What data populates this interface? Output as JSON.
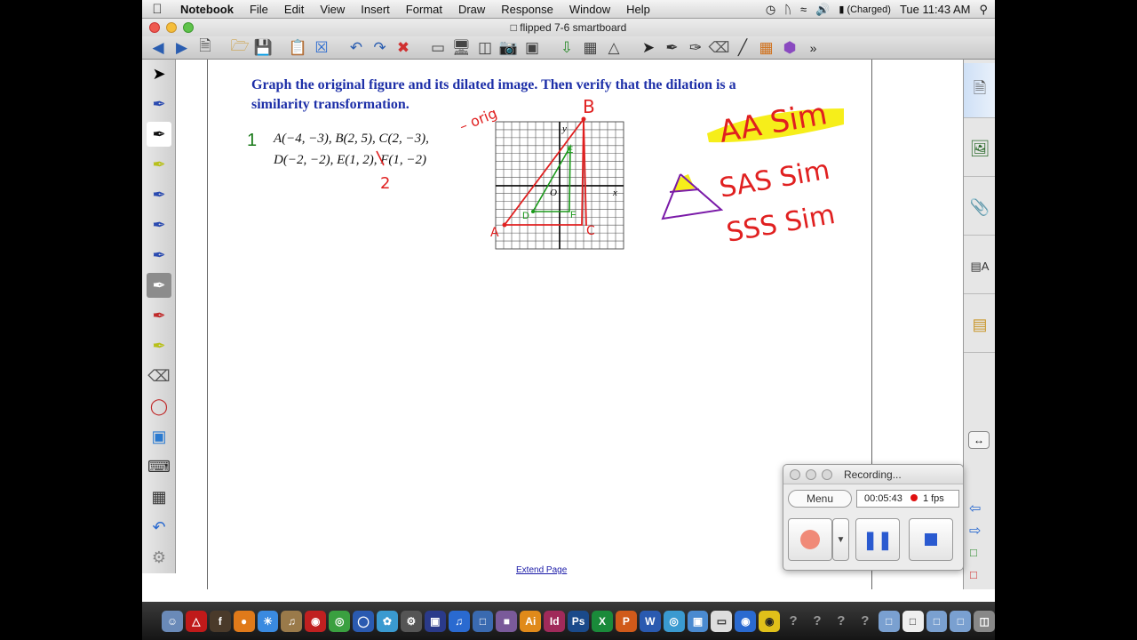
{
  "menubar": {
    "items": [
      "Notebook",
      "File",
      "Edit",
      "View",
      "Insert",
      "Format",
      "Draw",
      "Response",
      "Window",
      "Help"
    ],
    "battery": "(Charged)",
    "clock": "Tue 11:43 AM"
  },
  "window": {
    "title": "flipped 7-6 smartboard"
  },
  "page": {
    "heading": "Graph the original figure and its dilated image. Then verify that the dilation is a similarity transformation.",
    "problem_number": "1",
    "problem_line1": "A(−4, −3), B(2, 5), C(2, −3),",
    "problem_line2": "D(−2, −2), E(1, 2), F(1, −2)",
    "extend_link": "Extend Page"
  },
  "handwriting": {
    "orig_label": "– orig",
    "scale_label": "2",
    "point_labels": [
      "B",
      "A",
      "C",
      "E",
      "D",
      "F",
      "O",
      "x",
      "y"
    ],
    "criteria": [
      "AA Sim",
      "SAS Sim",
      "SSS Sim"
    ]
  },
  "recording": {
    "title": "Recording...",
    "menu_label": "Menu",
    "elapsed": "00:05:43",
    "fps": "1 fps"
  },
  "colors": {
    "heading": "#1d2fa8",
    "ink_red": "#e02020",
    "ink_green": "#1a9a1a",
    "highlight_yellow": "#f6ee1a",
    "ink_purple": "#7a1aa8"
  }
}
